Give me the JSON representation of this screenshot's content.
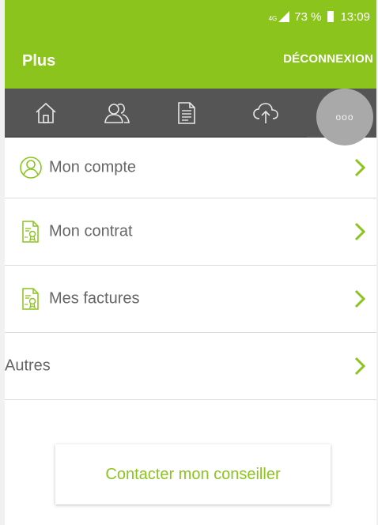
{
  "status_bar": {
    "network": "4G",
    "battery_percent": "73 %",
    "time": "13:09"
  },
  "header": {
    "title": "Plus",
    "logout_label": "DÉCONNEXION"
  },
  "tabs": [
    {
      "name": "home",
      "icon": "home-icon"
    },
    {
      "name": "people",
      "icon": "people-icon"
    },
    {
      "name": "document",
      "icon": "document-icon"
    },
    {
      "name": "cloud",
      "icon": "cloud-upload-icon"
    },
    {
      "name": "more",
      "icon": "more-icon",
      "active": true
    }
  ],
  "more_tab_label": "ooo",
  "menu": {
    "items": [
      {
        "label": "Mon compte",
        "icon": "user-circle-icon"
      },
      {
        "label": "Mon contrat",
        "icon": "certificate-icon"
      },
      {
        "label": "Mes factures",
        "icon": "certificate-icon"
      },
      {
        "label": "Autres",
        "icon": null
      }
    ]
  },
  "contact_button": {
    "label": "Contacter mon conseiller"
  },
  "colors": {
    "brand_green": "#8cc41e",
    "tab_bar": "#555555",
    "text_gray": "#666666"
  }
}
